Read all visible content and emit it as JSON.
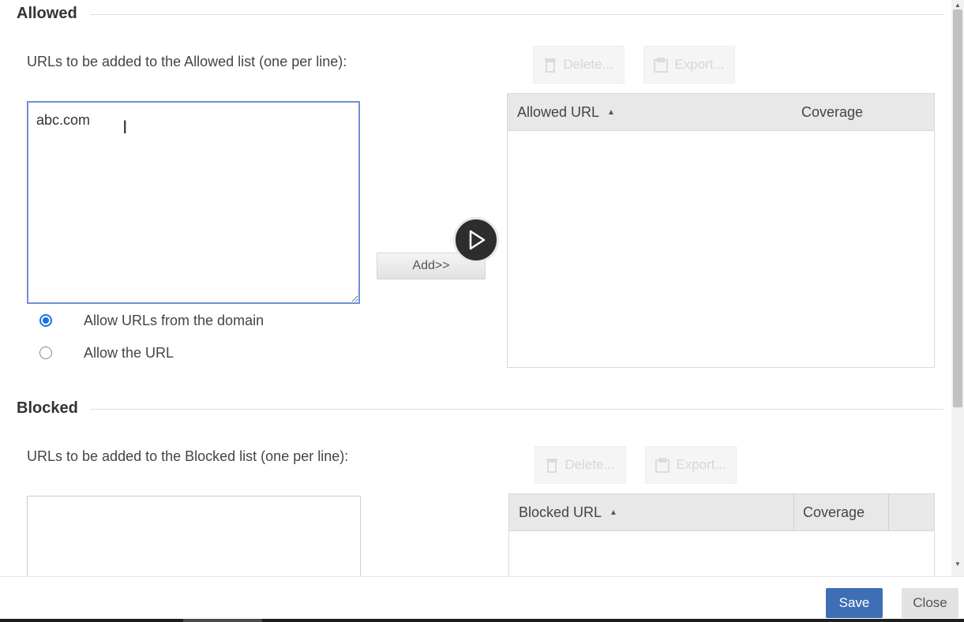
{
  "allowed": {
    "title": "Allowed",
    "description": "URLs to be added to the Allowed list (one per line):",
    "input_value": "abc.com",
    "add_label": "Add>>",
    "radio_options": [
      {
        "label": "Allow URLs from the domain",
        "checked": true
      },
      {
        "label": "Allow the URL",
        "checked": false
      }
    ],
    "delete_label": "Delete...",
    "export_label": "Export...",
    "grid": {
      "col_url": "Allowed URL",
      "col_coverage": "Coverage"
    }
  },
  "blocked": {
    "title": "Blocked",
    "description": "URLs to be added to the Blocked list (one per line):",
    "input_value": "",
    "delete_label": "Delete...",
    "export_label": "Export...",
    "grid": {
      "col_url": "Blocked URL",
      "col_coverage": "Coverage"
    }
  },
  "footer": {
    "save_label": "Save",
    "close_label": "Close"
  },
  "colors": {
    "accent": "#1a73e8",
    "save_button": "#3e6fb5",
    "focus_border": "#6e8fd6"
  },
  "icons": {
    "sort": "sort-ascending-icon",
    "play": "play-icon",
    "delete": "trash-icon",
    "export": "export-icon"
  }
}
